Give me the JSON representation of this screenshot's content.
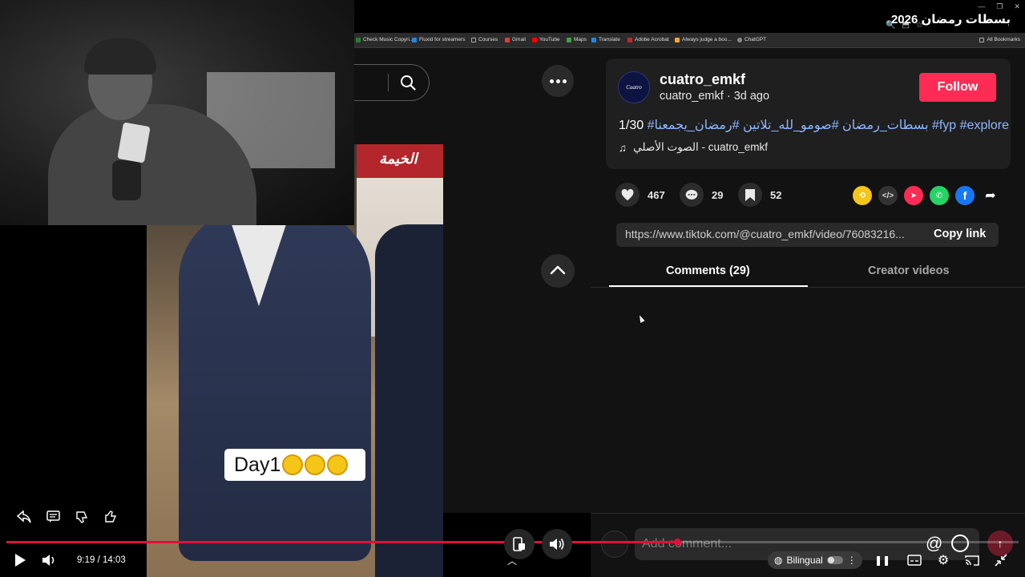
{
  "window": {
    "video_title": "بسطات رمضان 2026"
  },
  "bookmarks": {
    "items": [
      "Check Music Copyri...",
      "Fluxid for streamers",
      "Courses",
      "Gmail",
      "YouTube",
      "Maps",
      "Translate",
      "Adobe Acrobat",
      "Always judge a boo...",
      "ChatGPT"
    ],
    "all_bookmarks": "All Bookmarks"
  },
  "video": {
    "caption_text": "Day1",
    "stall_sign": "الخيمة"
  },
  "post": {
    "avatar_text": "Cuatro",
    "username": "cuatro_emkf",
    "handle": "cuatro_emkf",
    "age": "3d ago",
    "follow_label": "Follow",
    "description_prefix": "1/30",
    "hashtags": "#بسطات_رمضان #صومو_لله_تلاتين #رمضان_يجمعنا #fyp #explore",
    "music": "الصوت الأصلي - cuatro_emkf",
    "likes": "467",
    "comments": "29",
    "saves": "52",
    "link_url": "https://www.tiktok.com/@cuatro_emkf/video/76083216...",
    "copy_link_label": "Copy link",
    "tab_comments": "Comments (29)",
    "tab_creator": "Creator videos",
    "comment_placeholder": "Add comment..."
  },
  "player": {
    "time": "9:19 / 14:03",
    "progress_fraction": 0.663,
    "bilingual_label": "Bilingual"
  },
  "colors": {
    "follow": "#fe2c55",
    "hashtag": "#8fb8ff",
    "progress": "#e0103a"
  }
}
